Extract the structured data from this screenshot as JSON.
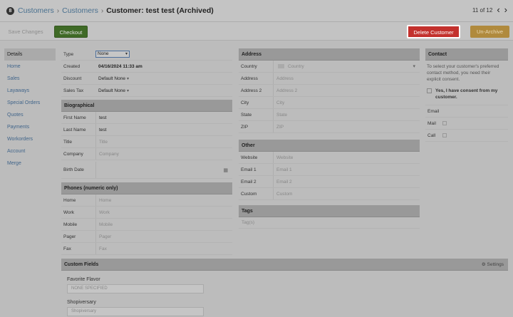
{
  "header": {
    "logo": "8",
    "crumb1": "Customers",
    "crumb2": "Customers",
    "title": "Customer: test test (Archived)",
    "pager": "11 of 12",
    "prev": "‹",
    "next": "›"
  },
  "toolbar": {
    "save_label": "Save Changes",
    "checkout_label": "Checkout",
    "delete_label": "Delete Customer",
    "unarchive_label": "Un-Archive"
  },
  "sidebar": {
    "items": [
      {
        "label": "Details"
      },
      {
        "label": "Home"
      },
      {
        "label": "Sales"
      },
      {
        "label": "Layaways"
      },
      {
        "label": "Special Orders"
      },
      {
        "label": "Quotes"
      },
      {
        "label": "Payments"
      },
      {
        "label": "Workorders"
      },
      {
        "label": "Account"
      },
      {
        "label": "Merge"
      }
    ]
  },
  "general": {
    "type_label": "Type",
    "type_value": "None",
    "created_label": "Created",
    "created_value": "04/16/2024 11:33 am",
    "discount_label": "Discount",
    "discount_value": "Default None",
    "tax_label": "Sales Tax",
    "tax_value": "Default None"
  },
  "biographical": {
    "heading": "Biographical",
    "first_name_label": "First Name",
    "first_name_value": "test",
    "last_name_label": "Last Name",
    "last_name_value": "test",
    "title_label": "Title",
    "title_placeholder": "Title",
    "company_label": "Company",
    "company_placeholder": "Company",
    "birth_label": "Birth Date"
  },
  "phones": {
    "heading": "Phones (numeric only)",
    "rows": [
      {
        "label": "Home",
        "placeholder": "Home"
      },
      {
        "label": "Work",
        "placeholder": "Work"
      },
      {
        "label": "Mobile",
        "placeholder": "Mobile"
      },
      {
        "label": "Pager",
        "placeholder": "Pager"
      },
      {
        "label": "Fax",
        "placeholder": "Fax"
      }
    ]
  },
  "address": {
    "heading": "Address",
    "country_label": "Country",
    "country_value": "Country",
    "rows": [
      {
        "label": "Address",
        "placeholder": "Address"
      },
      {
        "label": "Address 2",
        "placeholder": "Address 2"
      },
      {
        "label": "City",
        "placeholder": "City"
      },
      {
        "label": "State",
        "placeholder": "State"
      },
      {
        "label": "ZIP",
        "placeholder": "ZIP"
      }
    ]
  },
  "other": {
    "heading": "Other",
    "rows": [
      {
        "label": "Website",
        "placeholder": "Website"
      },
      {
        "label": "Email 1",
        "placeholder": "Email 1"
      },
      {
        "label": "Email 2",
        "placeholder": "Email 2"
      },
      {
        "label": "Custom",
        "placeholder": "Custom"
      }
    ]
  },
  "tags": {
    "heading": "Tags",
    "placeholder": "Tag(s)"
  },
  "contact": {
    "heading": "Contact",
    "note": "To select your customer's preferred contact method, you need their explicit consent.",
    "consent_label": "Yes, I have consent from my customer.",
    "methods": [
      {
        "label": "Email"
      },
      {
        "label": "Mail"
      },
      {
        "label": "Call"
      }
    ]
  },
  "custom_fields": {
    "heading": "Custom Fields",
    "settings_label": "⚙ Settings",
    "fields": [
      {
        "label": "Favorite Flavor",
        "value": "NONE SPECIFIED"
      },
      {
        "label": "Shopiversary",
        "value": "Shopiversary"
      }
    ]
  }
}
